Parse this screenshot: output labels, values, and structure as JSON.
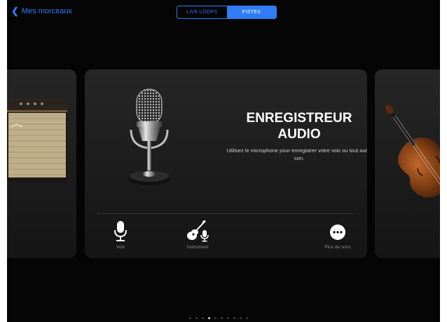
{
  "nav": {
    "back_label": "Mes morceaux"
  },
  "segments": {
    "live_loops": "LIVE LOOPS",
    "pistes": "PISTES",
    "selected": "PISTES"
  },
  "card": {
    "title_line1": "ENREGISTREUR",
    "title_line2": "AUDIO",
    "description": "Utilisez le microphone pour enregistrer votre voix ou tout autre son.",
    "options": [
      {
        "label": "Voix",
        "icon": "microphone-icon"
      },
      {
        "label": "Instrument",
        "icon": "guitar-mic-icon"
      },
      {
        "label": "Plus de sons",
        "icon": "more-icon"
      }
    ]
  },
  "pagination": {
    "total": 10,
    "current": 3
  },
  "colors": {
    "accent": "#2f7cf6",
    "background": "#050505",
    "card": "#222222"
  }
}
